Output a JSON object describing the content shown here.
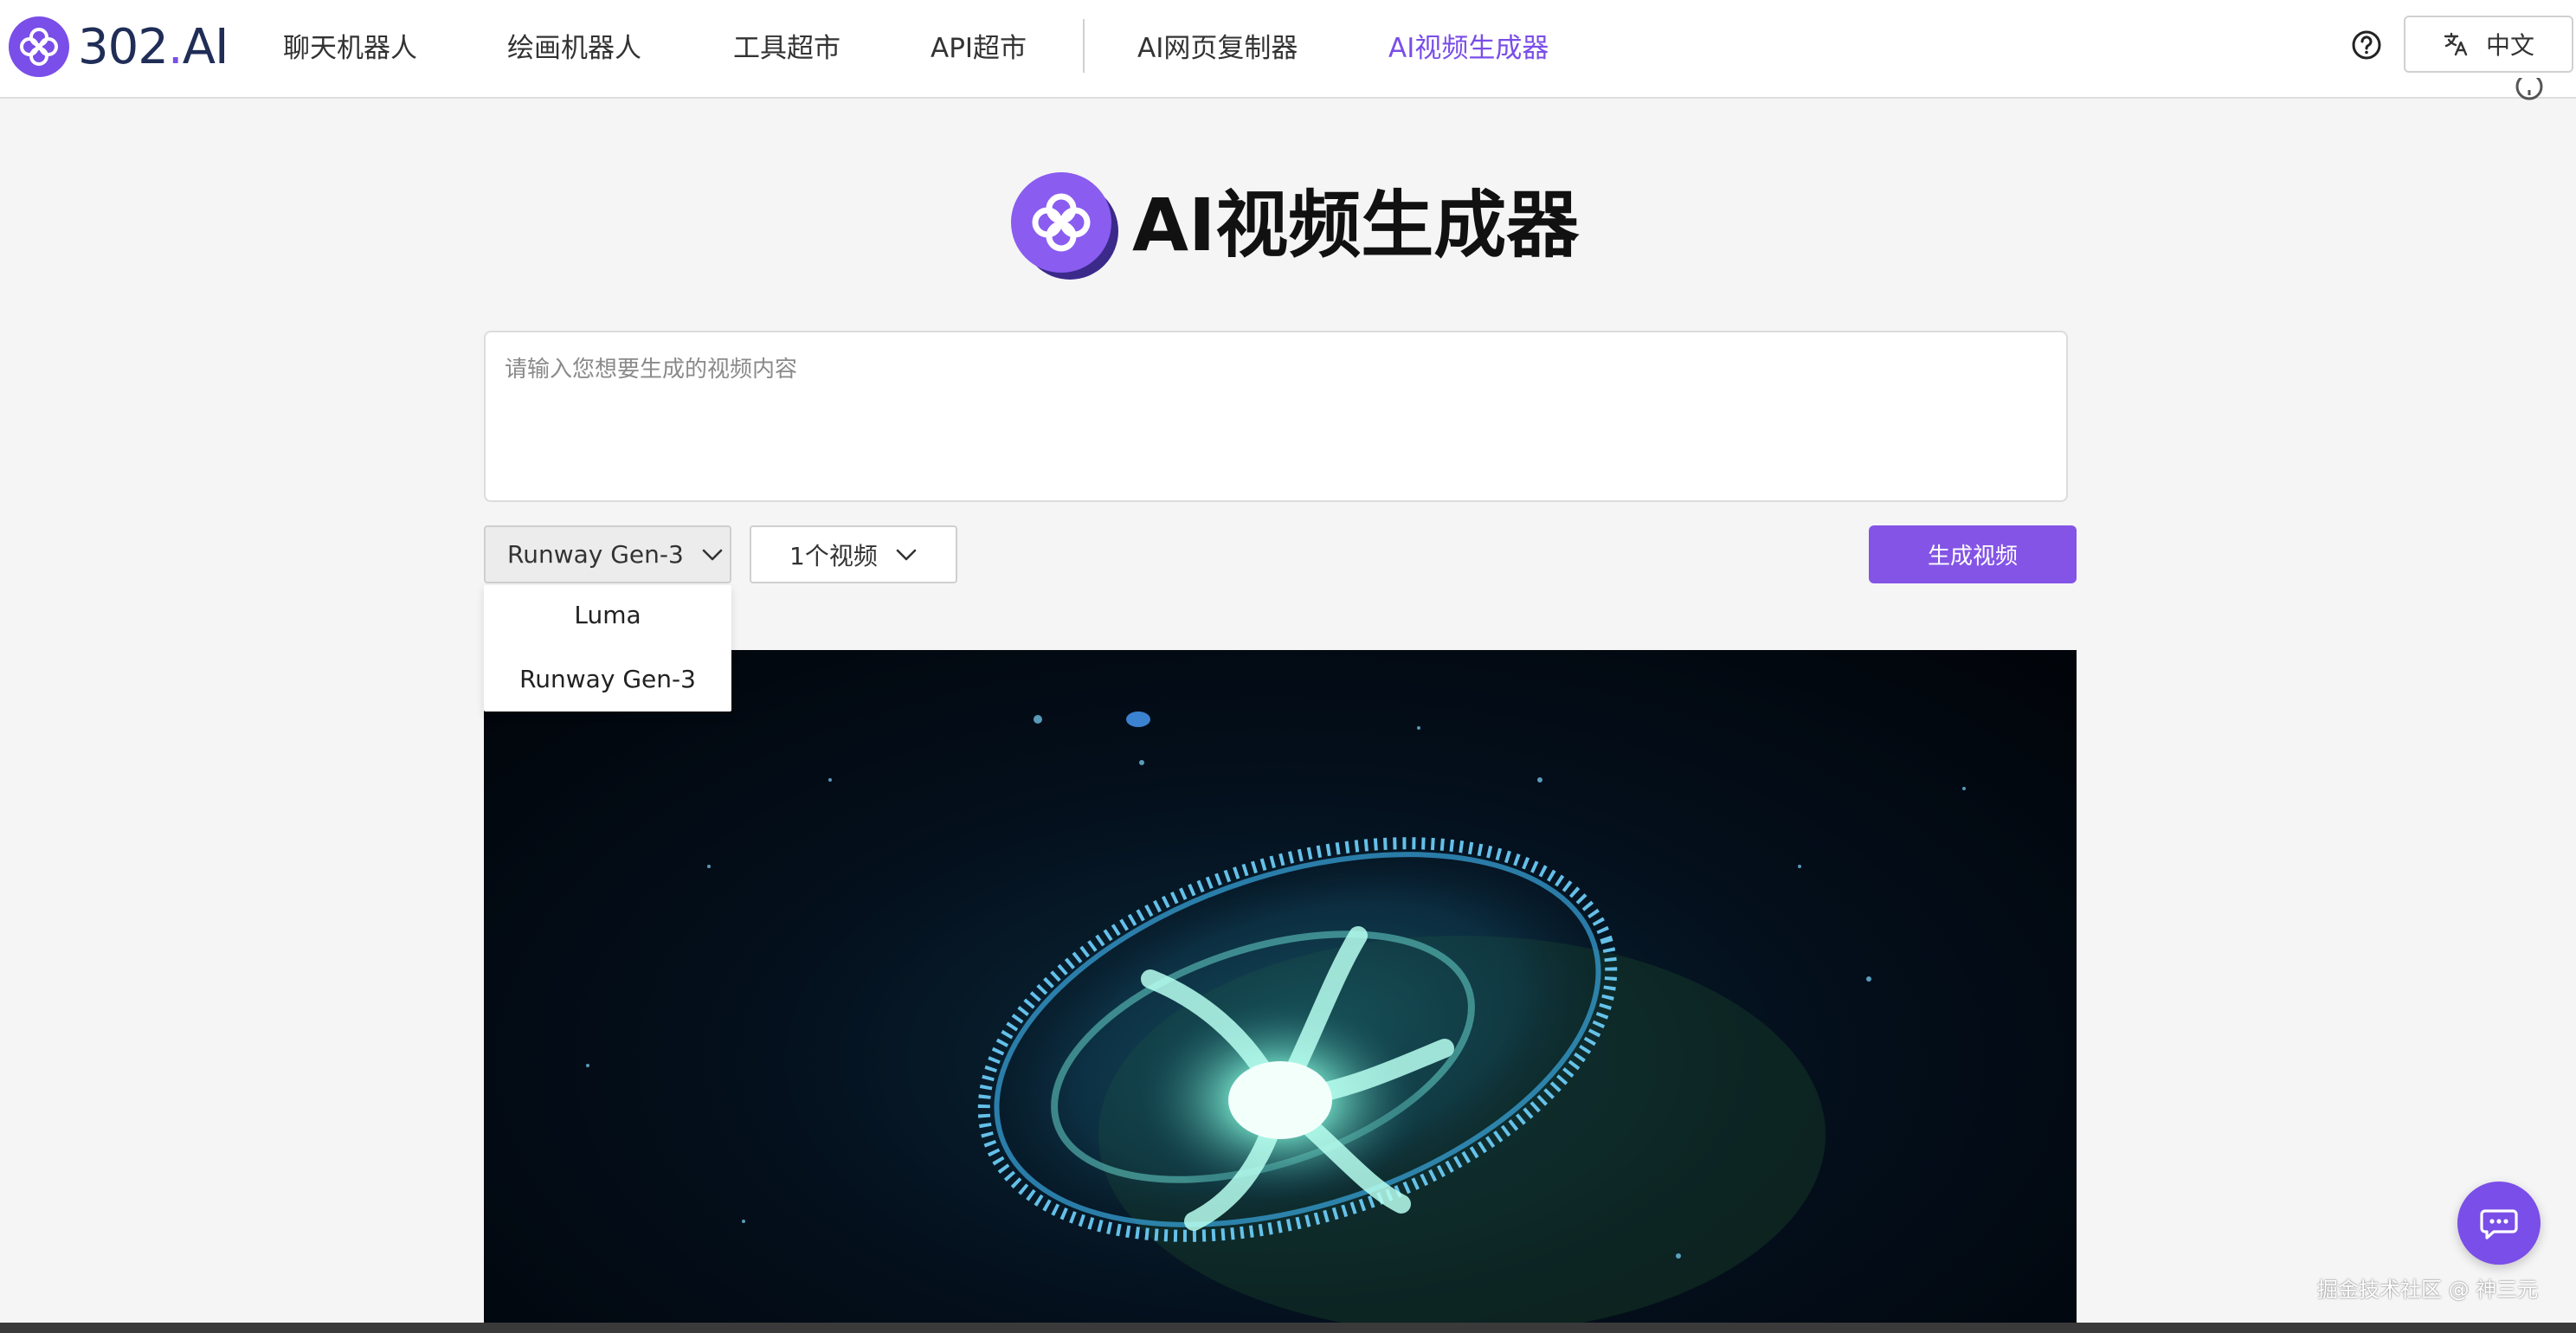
{
  "header": {
    "brand": {
      "prefix": "302",
      "dot": ".",
      "suffix": "AI"
    },
    "nav": [
      {
        "label": "聊天机器人",
        "active": false
      },
      {
        "label": "绘画机器人",
        "active": false
      },
      {
        "label": "工具超市",
        "active": false
      },
      {
        "label": "API超市",
        "active": false
      },
      {
        "label": "AI网页复制器",
        "active": false
      },
      {
        "label": "AI视频生成器",
        "active": true
      }
    ],
    "language_label": "中文"
  },
  "main": {
    "title": "AI视频生成器",
    "prompt_placeholder": "请输入您想要生成的视频内容",
    "model_select": {
      "selected": "Runway Gen-3",
      "options": [
        "Luma",
        "Runway Gen-3"
      ]
    },
    "count_select": {
      "selected": "1个视频"
    },
    "generate_label": "生成视频"
  },
  "watermark": "掘金技术社区 @ 神三元",
  "colors": {
    "accent": "#7a4ee8",
    "button": "#8454e6",
    "brand_text": "#1f2d57"
  },
  "icons": [
    "logo-icon",
    "help-icon",
    "translate-icon",
    "chevron-down-icon",
    "chat-icon"
  ]
}
